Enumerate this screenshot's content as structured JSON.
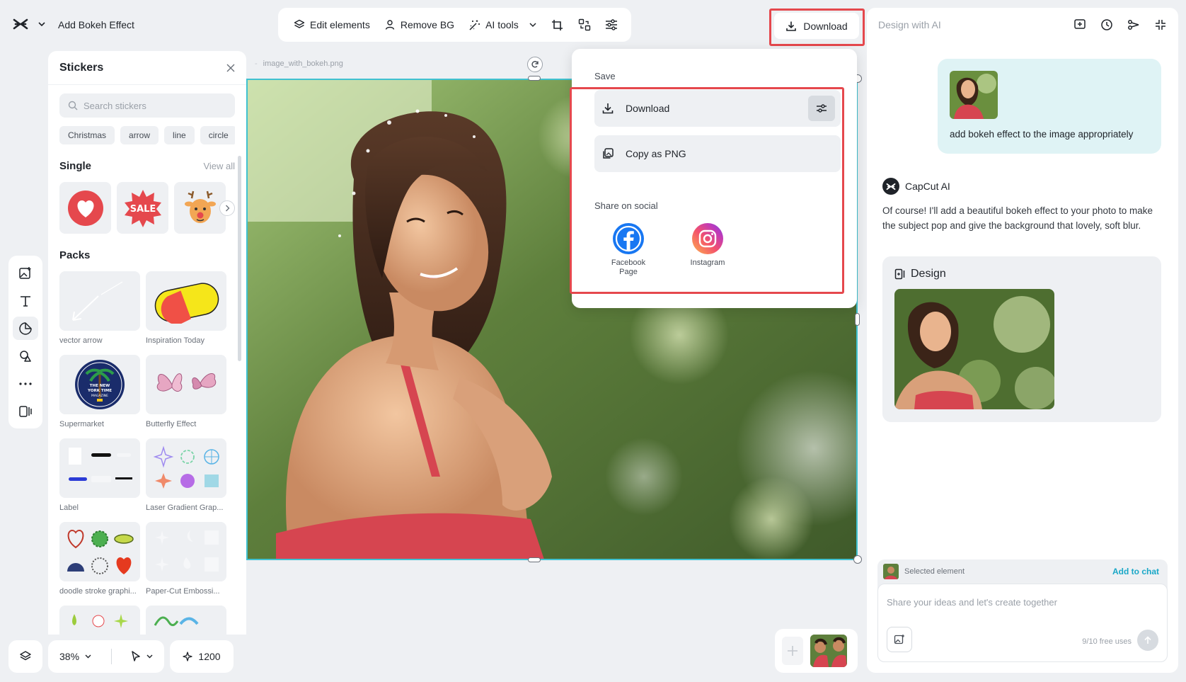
{
  "app": {
    "title": "Add Bokeh Effect"
  },
  "toolbar": {
    "edit_elements": "Edit elements",
    "remove_bg": "Remove BG",
    "ai_tools": "AI tools"
  },
  "download_button": {
    "label": "Download"
  },
  "stickers": {
    "title": "Stickers",
    "search_placeholder": "Search stickers",
    "chips": [
      "Christmas",
      "arrow",
      "line",
      "circle"
    ],
    "single_title": "Single",
    "view_all": "View all",
    "packs_title": "Packs",
    "packs": [
      {
        "label": "vector arrow"
      },
      {
        "label": "Inspiration Today"
      },
      {
        "label": "Supermarket"
      },
      {
        "label": "Butterfly Effect"
      },
      {
        "label": "Label"
      },
      {
        "label": "Laser Gradient Grap..."
      },
      {
        "label": "doodle stroke graphi..."
      },
      {
        "label": "Paper-Cut Embossi..."
      }
    ],
    "sale_text": "SALE",
    "supermarket_badge": {
      "top": "THE NEW",
      "mid": "YORK TIME",
      "bottom": "MAGAZINE"
    }
  },
  "canvas": {
    "file_name": "image_with_bokeh.png"
  },
  "dropdown": {
    "save_label": "Save",
    "download_label": "Download",
    "copy_png_label": "Copy as PNG",
    "share_label": "Share on social",
    "facebook_label": "Facebook Page",
    "instagram_label": "Instagram"
  },
  "bottom": {
    "zoom": "38%",
    "credits": "1200"
  },
  "ai_panel": {
    "placeholder_title": "Design with AI",
    "user_message": "add bokeh effect to the image appropriately",
    "assistant_name": "CapCut AI",
    "assistant_message": "Of course! I'll add a beautiful bokeh effect to your photo to make the subject pop and give the background that lovely, soft blur.",
    "design_title": "Design",
    "selected_element": "Selected element",
    "add_to_chat": "Add to chat",
    "chat_placeholder": "Share your ideas and let's create together",
    "free_uses": "9/10 free uses"
  },
  "colors": {
    "accent": "#3fc1d0",
    "highlight": "#e5484d",
    "link": "#19a7c7"
  }
}
